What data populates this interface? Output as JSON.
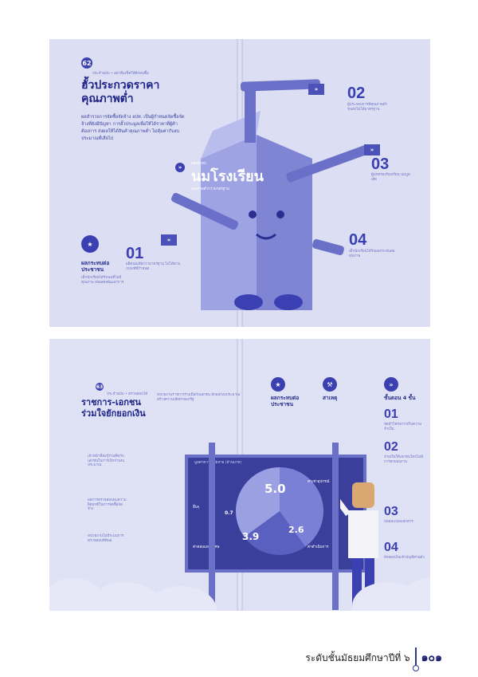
{
  "spread1": {
    "page_number": "62",
    "kicker": "ประจำฉบับ • อย่าลืมเช็คให้ดีก่อนซื้อ",
    "headline_line1": "ฮั้วประกวดราคา",
    "headline_line2": "คุณภาพต่ำ",
    "body": "ผลสำรวจการจัดซื้อจัดจ้าง อปท. เป็นผู้กำหนดจัดซื้อจัดจ้างที่ยังมีปัญหา การฮั้วประมูลเพื่อให้ได้ราคาที่ผู้ค้าต้องการ ส่งผลให้ได้สินค้าคุณภาพต่ำ ไม่คุ้มค่ากับงบประมาณที่เสียไป",
    "product_label": "ผลกระทบ",
    "product_name": "นมโรงเรียน",
    "product_sub": "คุณภาพต่ำกว่ามาตรฐาน",
    "step1_num": "01",
    "step1_text": "ผลิตนมเสียกว่ามาตรฐาน ไม่ได้ตามเกณฑ์ที่กำหนด",
    "step2_num": "02",
    "step2_text": "ผู้ประกอบการมีคุณภาพต่ำ ขนส่งไม่ได้มาตรฐาน",
    "step3_num": "03",
    "step3_text": "ผู้ปกครองร้องเรียน นมบูดเสีย",
    "step4_num": "04",
    "step4_text": "เด็กนักเรียนได้รับผลกระทบต่อสุขภาพ",
    "impact_title": "ผลกระทบต่อประชาชน",
    "impact_text": "เด็กนักเรียนได้รับนมที่ไม่มีคุณภาพ ส่งผลต่อพัฒนาการ"
  },
  "spread2": {
    "page_number": "63",
    "kicker": "ประจำฉบับ • ตรวจสอบได้",
    "headline_line1": "ราชการ-เอกชน",
    "headline_line2": "ร่วมใจยักยอกเงิน",
    "intro": "หน่วยงานราชการร่วมมือกับเอกชน ยักยอกงบประมาณ สร้างความเสียหายแก่รัฐ",
    "impact_title": "ผลกระทบต่อประชาชน",
    "cause_title": "สาเหตุ",
    "steps_title": "ขั้นตอน 4 ขั้น",
    "side_left_1": "เจ้าหน้าที่สมรู้ร่วมคิดกับเอกชนในการเบิกจ่ายงบประมาณ",
    "side_left_2": "ผลการตรวจสอบพบความผิดปกติในการจัดซื้อจัดจ้าง",
    "side_left_3": "หน่วยงานไม่มีระบบการตรวจสอบที่ดีพอ",
    "board_title": "มูลค่าความเสียหาย (ล้านบาท)",
    "board_value_main": "5.0",
    "board_value_a": "3.9",
    "board_value_b": "2.6",
    "board_value_c": "0.7",
    "board_label_main": "ค่าเช่าอุปกรณ์",
    "board_label_a": "ค่าตอบแทนพิเศษ",
    "board_label_b": "ค่าดำเนินการ",
    "board_label_c": "อื่นๆ",
    "s1": "01",
    "s1_text": "จัดทำโครงการเกินความจำเป็น",
    "s2": "02",
    "s2_text": "จ่ายเงินให้เอกชนโดยไม่มีการส่งมอบงาน",
    "s3": "03",
    "s3_text": "ปลอมแปลงเอกสาร",
    "s4": "04",
    "s4_text": "ยักยอกเงินเข้าบัญชีส่วนตัว"
  },
  "footer": {
    "caption": "ระดับชั้นมัธยมศึกษาปีที่ ๖",
    "page": "๑๐๑"
  }
}
